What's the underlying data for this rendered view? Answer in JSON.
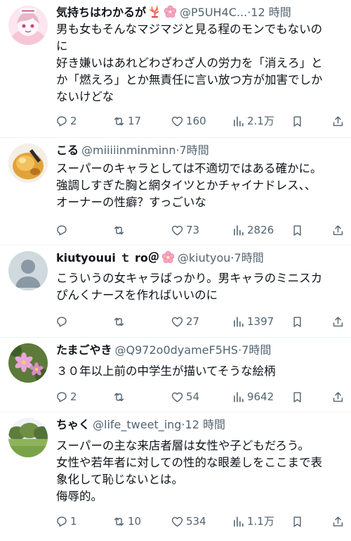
{
  "tweets": [
    {
      "name": "気持ちはわかるが",
      "emojis": [
        "coral-emoji",
        "cherry-blossom-emoji"
      ],
      "handle": "@P5UH4C...",
      "time": "12 時間",
      "body_lines": [
        "男も女もそんなマジマジと見る程のモンでもないの",
        "に",
        "好き嫌いはあれどわざわざ人の労力を「消えろ」と",
        "か「燃えろ」とか無責任に言い放つ方が加害でしか",
        "ないけどな"
      ],
      "replies": "2",
      "retweets": "17",
      "likes": "160",
      "views": "2.1万"
    },
    {
      "name": "こる",
      "emojis": [],
      "handle": "@miiiiinminminn",
      "time": "7時間",
      "body_lines": [
        "スーパーのキャラとしては不適切ではある確かに。",
        "強調しすぎた胸と網タイツとかチャイナドレス、、",
        "オーナーの性癖？すっごいな"
      ],
      "replies": "",
      "retweets": "",
      "likes": "73",
      "views": "2826"
    },
    {
      "name": "kiutyouui ｔ ro＠",
      "emojis": [
        "cherry-blossom-emoji"
      ],
      "handle": "@kiutyou",
      "time": "7時間",
      "body_lines": [
        "こういうの女キャラばっかり。男キャラのミニスカ",
        "ぴんくナースを作ればいいのに"
      ],
      "replies": "",
      "retweets": "",
      "likes": "27",
      "views": "1397"
    },
    {
      "name": "たまごやき",
      "emojis": [],
      "handle": "@Q972o0dyameF5HS",
      "time": "7時間",
      "body_lines": [
        "３０年以上前の中学生が描いてそうな絵柄"
      ],
      "replies": "2",
      "retweets": "",
      "likes": "54",
      "views": "9642"
    },
    {
      "name": "ちゃく",
      "emojis": [],
      "handle": "@life_tweet_ing",
      "time": "12 時間",
      "body_lines": [
        "スーパーの主な来店者層は女性や子どもだろう。",
        "女性や若年者に対しての性的な眼差しをここまで表",
        "象化して恥じないとは。",
        "侮辱的。"
      ],
      "replies": "1",
      "retweets": "10",
      "likes": "534",
      "views": "1.1万"
    }
  ],
  "separator": "·",
  "icons": {
    "reply": "reply-icon",
    "retweet": "retweet-icon",
    "like": "heart-icon",
    "views": "views-icon",
    "bookmark": "bookmark-icon",
    "share": "share-icon"
  },
  "colors": {
    "text": "#0f1419",
    "secondary": "#536471",
    "divider": "#eff3f4",
    "background": "#ffffff"
  }
}
